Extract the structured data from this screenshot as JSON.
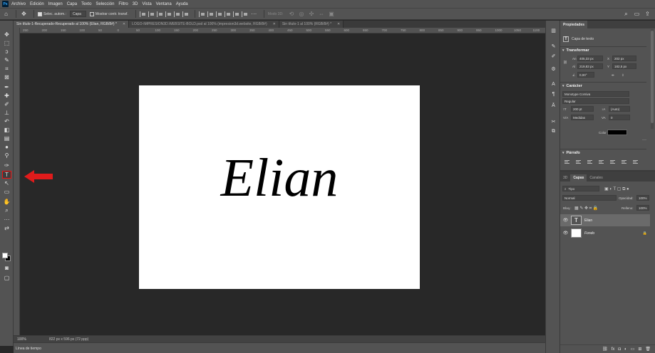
{
  "app": {
    "logo": "Ps"
  },
  "menu": [
    "Archivo",
    "Edición",
    "Imagen",
    "Capa",
    "Texto",
    "Selección",
    "Filtro",
    "3D",
    "Vista",
    "Ventana",
    "Ayuda"
  ],
  "options": {
    "auto_select_label": "Selec. autom.:",
    "auto_select_value": "Capa",
    "transform_label": "Mostrar contr. transf.",
    "mode3d_label": "Modo 3D:"
  },
  "tabs": [
    {
      "label": "Sin título-1-Recuperado-Recuperado al 100% (Elian, RGB/8#) *",
      "active": true
    },
    {
      "label": "LOGO-IMPRESION3D.WEBSITE-BOLD.psd al 100% (impresion3d.website, RGB/8#)",
      "active": false
    },
    {
      "label": "Sin título-1 al 100% (RGB/8#) *",
      "active": false
    }
  ],
  "ruler_ticks": [
    "250",
    "200",
    "150",
    "100",
    "50",
    "0",
    "50",
    "100",
    "150",
    "200",
    "250",
    "300",
    "350",
    "400",
    "450",
    "500",
    "550",
    "600",
    "650",
    "700",
    "750",
    "800",
    "850",
    "900",
    "950",
    "1000",
    "1050",
    "1100"
  ],
  "document": {
    "text": "Elian"
  },
  "status": {
    "zoom": "100%",
    "doc_size": "822 px x 596 px (72 ppp)"
  },
  "timeline_label": "Línea de tiempo",
  "properties": {
    "tab_label": "Propiedades",
    "layer_type": "Capa de texto",
    "transform_title": "Transformar",
    "an_label": "An",
    "an_value": "405,33 px",
    "al_label": "Al",
    "al_value": "219,83 px",
    "x_label": "X",
    "x_value": "202 px",
    "y_label": "Y",
    "y_value": "182,5 px",
    "angle_value": "0,00°",
    "char_title": "Carácter",
    "font_family": "Monotype Corsiva",
    "font_style": "Regular",
    "font_size": "200 pt",
    "leading": "(Auto)",
    "kerning": "Medidas",
    "tracking": "0",
    "color_label": "Color",
    "para_title": "Párrafo",
    "more": "···"
  },
  "layers_panel": {
    "tabs": [
      "3D",
      "Capas",
      "Canales"
    ],
    "filter_value": "Tipo",
    "blend_mode": "Normal",
    "opacity_label": "Opacidad:",
    "opacity_value": "100%",
    "lock_label": "Bloq.:",
    "fill_label": "Relleno:",
    "fill_value": "100%",
    "layers": [
      {
        "name": "Elian",
        "type": "text",
        "selected": true
      },
      {
        "name": "Fondo",
        "type": "background",
        "selected": false
      }
    ],
    "footer_icons": [
      "link-icon",
      "fx-icon",
      "mask-icon",
      "adjustment-icon",
      "folder-icon",
      "new-layer-icon",
      "trash-icon"
    ]
  },
  "colors": {
    "accent_red": "#e01b1b",
    "panel": "#535353",
    "canvas": "#282828"
  }
}
